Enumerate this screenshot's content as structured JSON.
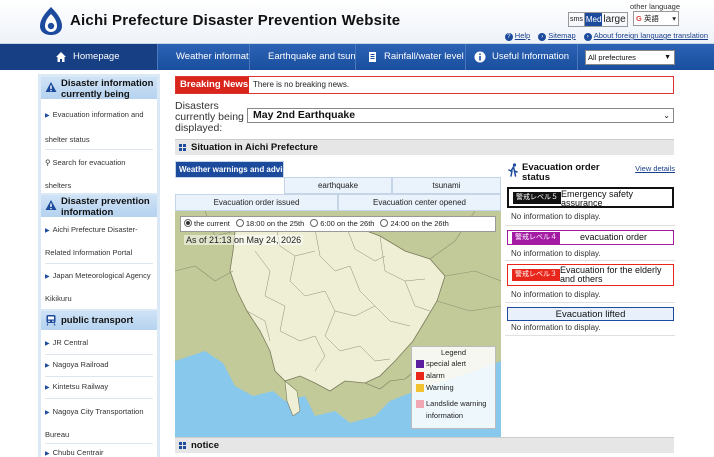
{
  "header": {
    "site_title": "Aichi Prefecture Disaster Prevention Website",
    "other_language": "other language",
    "text_size": {
      "small": "sms",
      "medium": "Med",
      "large": "large"
    },
    "language_select": "英語",
    "links": {
      "help": "Help",
      "sitemap": "Sitemap",
      "foreign": "About foreign language translation"
    }
  },
  "nav": {
    "items": [
      {
        "label": "Homepage"
      },
      {
        "label": "Weather information"
      },
      {
        "label": "Earthquake and tsunami"
      },
      {
        "label": "Rainfall/water level"
      },
      {
        "label": "Useful Information"
      }
    ],
    "prefecture_select": "All prefectures"
  },
  "sidebar": {
    "disaster_info": {
      "title": "Disaster information currently being displayed",
      "links": [
        "Evacuation information and shelter status",
        "Search for evacuation shelters"
      ]
    },
    "prevention": {
      "title": "Disaster prevention information",
      "links": [
        "Aichi Prefecture Disaster-Related Information Portal",
        "Japan Meteorological Agency Kikikuru"
      ]
    },
    "transport": {
      "title": "public transport",
      "links": [
        "JR Central",
        "Nagoya Railroad",
        "Kintetsu Railway",
        "Nagoya City Transportation Bureau",
        "Chubu Centrair"
      ]
    }
  },
  "breaking": {
    "label": "Breaking News",
    "text": "There is no breaking news."
  },
  "disaster_select": {
    "label": "Disasters currently being displayed:",
    "value": "May 2nd Earthquake"
  },
  "situation": {
    "title": "Situation in Aichi Prefecture",
    "tabs": {
      "weather": "Weather warnings and advisories",
      "earthquake": "earthquake",
      "tsunami": "tsunami",
      "evac_order": "Evacuation order issued",
      "evac_center": "Evacuation center opened"
    },
    "times": [
      "the current",
      "18:00 on the 25th",
      "6:00 on the 26th",
      "24:00 on the 26th"
    ],
    "selected_time_index": 0,
    "as_of": "As of 21:13 on May 24, 2026",
    "legend": {
      "title": "Legend",
      "items": [
        {
          "label": "special alert",
          "color": "#5b1e9e"
        },
        {
          "label": "alarm",
          "color": "#e8261b"
        },
        {
          "label": "Warning",
          "color": "#f2c230"
        },
        {
          "label": "Landslide warning information",
          "color": "#f2a8b4"
        }
      ]
    }
  },
  "evacuation": {
    "title": "Evacuation order status",
    "view_details": "View details",
    "levels": [
      {
        "badge": "警戒レベル５",
        "label": "Emergency safety assurance",
        "status": "No information to display.",
        "color": "#111111"
      },
      {
        "badge": "警戒レベル４",
        "label": "evacuation order",
        "status": "No information to display.",
        "color": "#a31ba3"
      },
      {
        "badge": "警戒レベル３",
        "label": "Evacuation for the elderly and others",
        "status": "No information to display.",
        "color": "#e8261b"
      }
    ],
    "lifted": {
      "label": "Evacuation lifted",
      "status": "No information to display."
    }
  },
  "notice": {
    "title": "notice"
  }
}
